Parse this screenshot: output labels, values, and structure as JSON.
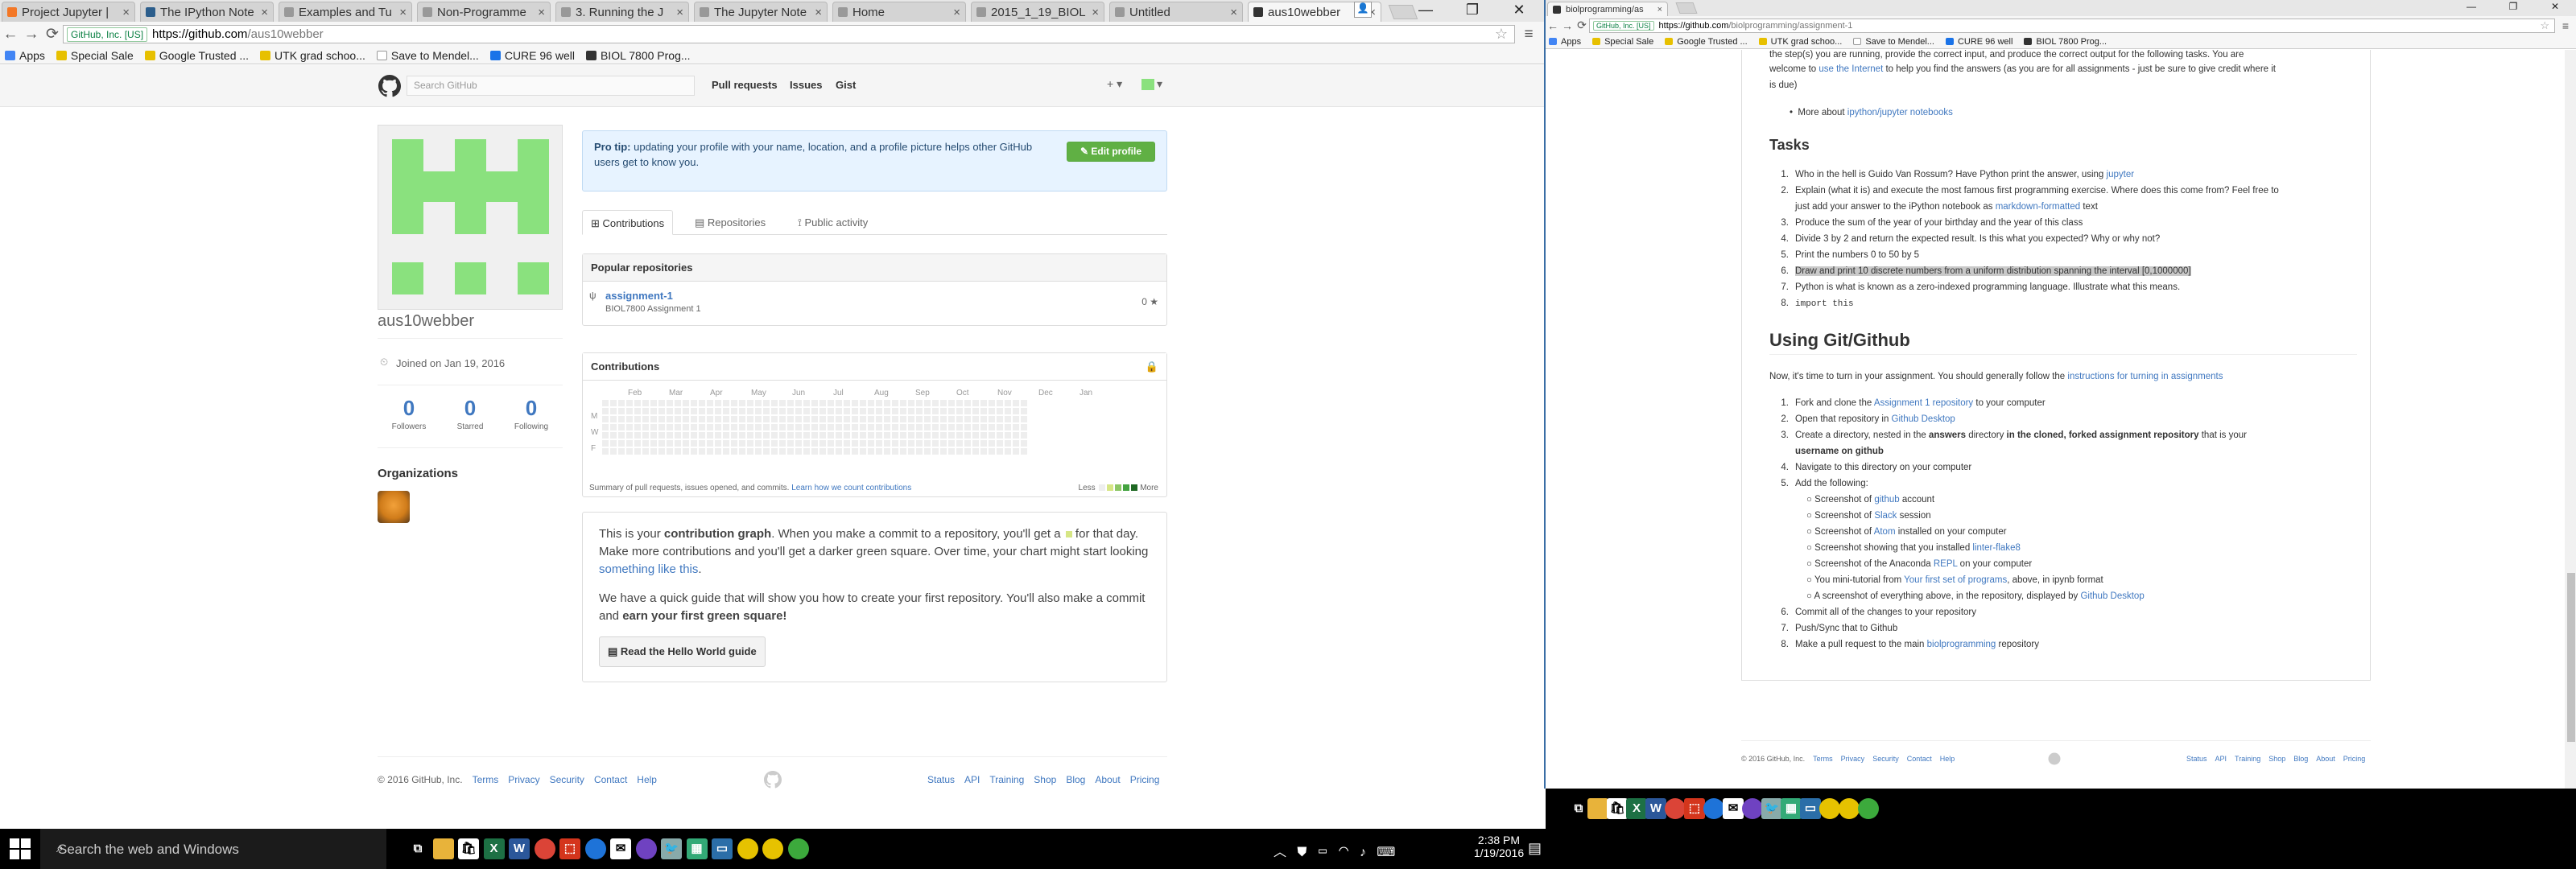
{
  "left_browser": {
    "tabs": [
      {
        "title": "Project Jupyter |",
        "fav": "#f37726"
      },
      {
        "title": "The IPython Note",
        "fav": "#2c5e8c"
      },
      {
        "title": "Examples and Tu",
        "fav": "#999999"
      },
      {
        "title": "Non-Programme",
        "fav": "#999999"
      },
      {
        "title": "3. Running the J",
        "fav": "#999999"
      },
      {
        "title": "The Jupyter Note",
        "fav": "#999999"
      },
      {
        "title": "Home",
        "fav": "#999999"
      },
      {
        "title": "2015_1_19_BIOL",
        "fav": "#999999"
      },
      {
        "title": "Untitled",
        "fav": "#999999"
      },
      {
        "title": "aus10webber",
        "fav": "#333333"
      }
    ],
    "tab_close": "×",
    "security": "GitHub, Inc. [US]",
    "url_domain": "https://github.com",
    "url_path": "/aus10webber",
    "bookmarks": [
      "Apps",
      "Special Sale",
      "Google Trusted ...",
      "UTK grad schoo...",
      "Save to Mendel...",
      "CURE 96 well",
      "BIOL 7800 Prog..."
    ],
    "github": {
      "search_placeholder": "Search GitHub",
      "nav": [
        "Pull requests",
        "Issues",
        "Gist"
      ],
      "plus": "+ ▾",
      "username": "aus10webber",
      "joined": "Joined on Jan 19, 2016",
      "stats": [
        {
          "n": "0",
          "l": "Followers"
        },
        {
          "n": "0",
          "l": "Starred"
        },
        {
          "n": "0",
          "l": "Following"
        }
      ],
      "organizations": "Organizations",
      "protip_bold": "Pro tip:",
      "protip": " updating your profile with your name, location, and a profile picture helps other GitHub users get to know you.",
      "edit_profile": "✎ Edit profile",
      "tabs": [
        "Contributions",
        "Repositories",
        "Public activity"
      ],
      "popular_repos": "Popular repositories",
      "repo_name": "assignment-1",
      "repo_desc": "BIOL7800 Assignment 1",
      "repo_stars": "0 ★",
      "contributions": "Contributions",
      "months": [
        "Feb",
        "Mar",
        "Apr",
        "May",
        "Jun",
        "Jul",
        "Aug",
        "Sep",
        "Oct",
        "Nov",
        "Dec",
        "Jan"
      ],
      "days": [
        "M",
        "W",
        "F"
      ],
      "summary": "Summary of pull requests, issues opened, and commits.",
      "learn": "Learn how we count contributions",
      "less": "Less",
      "more": "More",
      "blank_p1a": "This is your ",
      "blank_p1b": "contribution graph",
      "blank_p1c": ". When you make a commit to a repository, you'll get a ",
      "blank_p1d": " for that day. Make more contributions and you'll get a darker green square. Over time, your chart might start looking ",
      "blank_p1e": "something like this",
      "blank_p1f": ".",
      "blank_p2a": "We have a quick guide that will show you how to create your first repository. You'll also make a commit and ",
      "blank_p2b": "earn your first green square!",
      "guide_btn": "Read the Hello World guide",
      "footer_copy": "© 2016 GitHub, Inc.",
      "footer_left": [
        "Terms",
        "Privacy",
        "Security",
        "Contact",
        "Help"
      ],
      "footer_right": [
        "Status",
        "API",
        "Training",
        "Shop",
        "Blog",
        "About",
        "Pricing"
      ]
    }
  },
  "right_browser": {
    "tab_title": "biolprogramming/as",
    "tab_close": "×",
    "security": "GitHub, Inc. [US]",
    "url_domain": "https://github.com",
    "url_path": "/biolprogramming/assignment-1",
    "bookmarks": [
      "Apps",
      "Special Sale",
      "Google Trusted ...",
      "UTK grad schoo...",
      "Save to Mendel...",
      "CURE 96 well",
      "BIOL 7800 Prog..."
    ],
    "intro_a": "the step(s) you are running, provide the correct input, and produce the correct output for the following tasks. You are",
    "intro_b1": "welcome to ",
    "intro_b2": "use the Internet",
    "intro_b3": " to help you find the answers (as you are for all assignments - just be sure to give credit where it",
    "intro_c": "is due)",
    "more_about_a": "More about ",
    "more_about_b": "ipython/jupyter notebooks",
    "tasks_heading": "Tasks",
    "tasks": [
      {
        "a": "Who in the hell is Guido Van Rossum? Have Python print the answer, using ",
        "link": "jupyter",
        "b": ""
      },
      {
        "a": "Explain (what it is) and execute the most famous first programming exercise. Where does this come from? Feel free to",
        "link": "",
        "b": ""
      },
      {
        "a": "just add your answer to the iPython notebook as ",
        "link": "markdown-formatted",
        "b": " text"
      },
      {
        "a": "Produce the sum of the year of your birthday and the year of this class",
        "link": "",
        "b": ""
      },
      {
        "a": "Divide 3 by 2 and return the expected result. Is this what you expected? Why or why not?",
        "link": "",
        "b": ""
      },
      {
        "a": "Print the numbers 0 to 50 by 5",
        "link": "",
        "b": ""
      },
      {
        "a": "Draw and print 10 discrete numbers from a uniform distribution spanning the interval [0,1000000]",
        "link": "",
        "b": ""
      },
      {
        "a": "Python is what is known as a zero-indexed programming language. Illustrate what this means.",
        "link": "",
        "b": ""
      },
      {
        "a": "import this",
        "link": "",
        "b": ""
      }
    ],
    "task_nums": [
      "1.",
      "2.",
      "",
      "3.",
      "4.",
      "5.",
      "6.",
      "7.",
      "8."
    ],
    "git_heading": "Using Git/Github",
    "git_intro_a": "Now, it's time to turn in your assignment. You should generally follow the ",
    "git_intro_b": "instructions for turning in assignments",
    "steps": [
      {
        "n": "1.",
        "a": "Fork and clone the ",
        "link": "Assignment 1 repository",
        "b": " to your computer"
      },
      {
        "n": "2.",
        "a": "Open that repository in ",
        "link": "Github Desktop",
        "b": ""
      },
      {
        "n": "3.",
        "a": "Create a directory, nested in the ",
        "bold": "answers",
        "c": " directory ",
        "bold2": "in the cloned, forked assignment repository",
        "d": " that is your"
      },
      {
        "n": "",
        "bold": "username on github"
      },
      {
        "n": "4.",
        "a": "Navigate to this directory on your computer",
        "link": "",
        "b": ""
      },
      {
        "n": "5.",
        "a": "Add the following:",
        "link": "",
        "b": ""
      }
    ],
    "subitems": [
      {
        "a": "Screenshot of ",
        "link": "github",
        "b": " account"
      },
      {
        "a": "Screenshot of ",
        "link": "Slack",
        "b": " session"
      },
      {
        "a": "Screenshot of ",
        "link": "Atom",
        "b": " installed on your computer"
      },
      {
        "a": "Screenshot showing that you installed ",
        "link": "linter-flake8",
        "b": ""
      },
      {
        "a": "Screenshot of the Anaconda ",
        "link": "REPL",
        "b": " on your computer"
      },
      {
        "a": "You mini-tutorial from ",
        "link": "Your first set of programs",
        "b": ", above, in ipynb format"
      },
      {
        "a": "A screenshot of everything above, in the repository, displayed by ",
        "link": "Github Desktop",
        "b": ""
      }
    ],
    "steps2": [
      {
        "n": "6.",
        "a": "Commit all of the changes to your repository",
        "link": "",
        "b": ""
      },
      {
        "n": "7.",
        "a": "Push/Sync that to Github",
        "link": "",
        "b": ""
      },
      {
        "n": "8.",
        "a": "Make a pull request to the main ",
        "link": "biolprogramming",
        "b": " repository"
      }
    ],
    "footer_copy": "© 2016 GitHub, Inc.",
    "footer_left": [
      "Terms",
      "Privacy",
      "Security",
      "Contact",
      "Help"
    ],
    "footer_right": [
      "Status",
      "API",
      "Training",
      "Shop",
      "Blog",
      "About",
      "Pricing"
    ]
  },
  "taskbar": {
    "search": "Search the web and Windows",
    "time": "2:38 PM",
    "date": "1/19/2016"
  }
}
